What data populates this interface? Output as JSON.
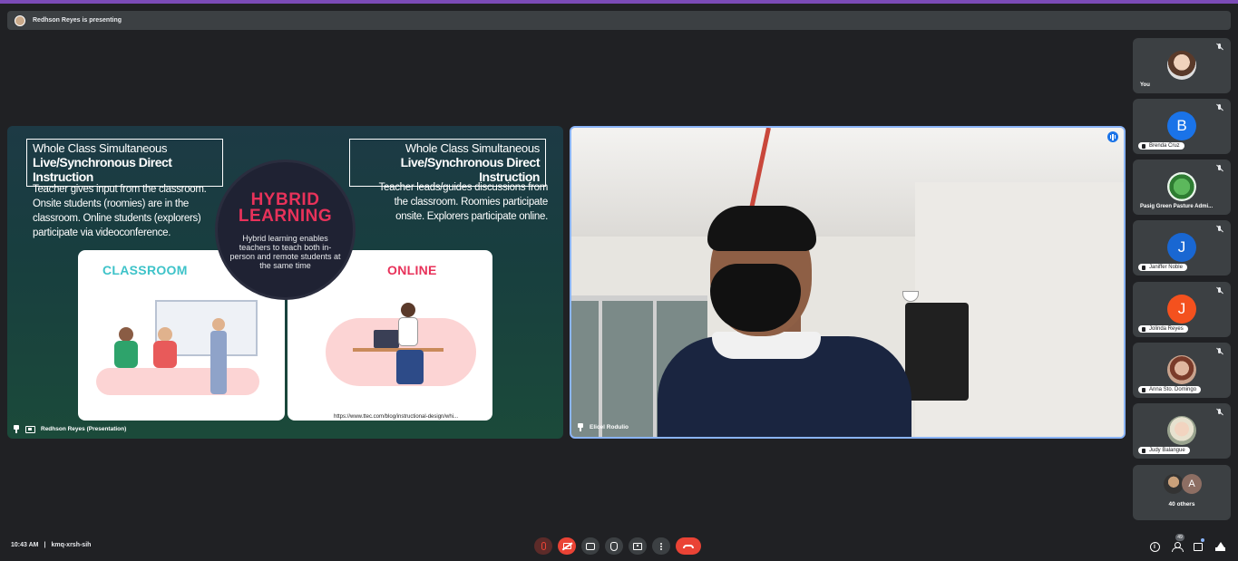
{
  "banner": {
    "presenter_text": "Redhson Reyes is presenting"
  },
  "presentation": {
    "label": "Redhson Reyes (Presentation)",
    "slide": {
      "left_box_line1": "Whole Class Simultaneous",
      "left_box_line2": "Live/Synchronous Direct Instruction",
      "right_box_line1": "Whole Class Simultaneous",
      "right_box_line2": "Live/Synchronous Direct Instruction",
      "left_text": "Teacher gives input from the classroom. Onsite students (roomies) are in the classroom. Online students (explorers) participate via videoconference.",
      "right_text": "Teacher leads/guides discussions from the classroom. Roomies participate onsite. Explorers participate online.",
      "circle_title_1": "HYBRID",
      "circle_title_2": "LEARNING",
      "circle_text": "Hybrid learning enables teachers to teach both in-person and remote students at the same time",
      "card_left_title": "CLASSROOM",
      "card_right_title": "ONLINE",
      "url": "https://www.ttec.com/blog/instructional-design/whi..."
    }
  },
  "speaker": {
    "name": "Elicel Rodulio"
  },
  "participants": [
    {
      "name": "You",
      "initial": "",
      "color": "#ffffff"
    },
    {
      "name": "Brenda Cruz",
      "initial": "B",
      "color": "#1a73e8"
    },
    {
      "name": "Pasig Green Pasture Admi...",
      "initial": "",
      "color": "#2e7d32"
    },
    {
      "name": "Janiffer Noble",
      "initial": "J",
      "color": "#1967d2"
    },
    {
      "name": "Jolinda Reyes",
      "initial": "J",
      "color": "#f4511e"
    },
    {
      "name": "Anna Sto. Domingo",
      "initial": "",
      "color": "#c9a38d"
    },
    {
      "name": "Judy Balangue",
      "initial": "",
      "color": "#e7e2cf"
    }
  ],
  "others": {
    "label": "40 others",
    "initial": "A"
  },
  "footer": {
    "time": "10:43 AM",
    "separator": "|",
    "meeting_code": "kmq-xrsh-sih",
    "people_count": "49"
  }
}
